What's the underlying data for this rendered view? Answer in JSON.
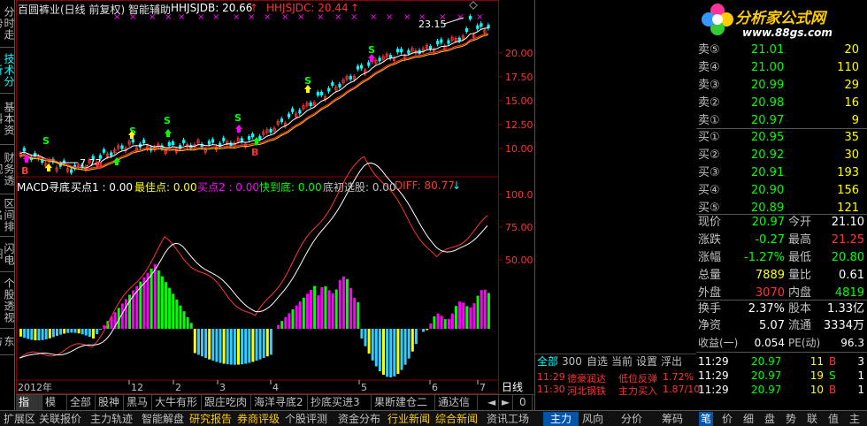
{
  "left_tabs": [
    {
      "label": "分时走势"
    },
    {
      "label": "技术分析"
    },
    {
      "label": "基本资料"
    },
    {
      "label": "财务透视"
    },
    {
      "label": "区间排名"
    },
    {
      "label": "闪电图"
    },
    {
      "label": "个股透视"
    },
    {
      "label": "东方"
    }
  ],
  "header": {
    "title": "百圆裤业(日线 前复权) 智能辅助",
    "ind1": "HHJSJDB: 20.66",
    "ind2": "HHJSJDC: 20.44",
    "arrow": "↑",
    "peak_label": "23.15",
    "low_label": "7.77"
  },
  "price_axis": [
    "20.00",
    "17.50",
    "15.00",
    "12.50",
    "10.00"
  ],
  "macd_header": {
    "title": "MACD寻底",
    "p1": "买点1 : 0.00",
    "p2": "最佳点: 0.00",
    "p3": "买点2 : 0.00",
    "p4": "快到底: 0.00",
    "p5": "底初选股: 0.00",
    "p6": "DIFF: 80.77",
    "arrow": "↓"
  },
  "macd_axis": [
    "100.0",
    "75.00",
    "50.00"
  ],
  "date_axis": {
    "year": "2012年",
    "months": [
      "12",
      "2",
      "3",
      "4",
      "5",
      "6",
      "7"
    ]
  },
  "signals": {
    "s": "S",
    "b": "B"
  },
  "bottom_tabs": [
    "指标",
    "模板",
    "全部",
    "股神",
    "黑马",
    "大牛有形",
    "跟庄吃肉",
    "海洋寻底2",
    "抄底买进3",
    "果断建仓二",
    "通达信"
  ],
  "status_tabs": [
    "扩展区",
    "关联报价",
    "主力轨迹",
    "智能解盘",
    "研究报告",
    "券商评级",
    "个股评测",
    "资金分布",
    "行业新闻",
    "综合新闻",
    "资讯工场"
  ],
  "logo": {
    "title": "分析家公式网",
    "url": "www.88gs.com"
  },
  "quote": {
    "sells": [
      {
        "l": "卖⑤",
        "p": "21.01",
        "v": "20"
      },
      {
        "l": "卖④",
        "p": "21.00",
        "v": "110"
      },
      {
        "l": "卖③",
        "p": "20.99",
        "v": "29"
      },
      {
        "l": "卖②",
        "p": "20.98",
        "v": "16"
      },
      {
        "l": "卖①",
        "p": "20.97",
        "v": "9"
      }
    ],
    "buys": [
      {
        "l": "买①",
        "p": "20.95",
        "v": "35"
      },
      {
        "l": "买②",
        "p": "20.92",
        "v": "30"
      },
      {
        "l": "买③",
        "p": "20.91",
        "v": "193"
      },
      {
        "l": "买④",
        "p": "20.90",
        "v": "156"
      },
      {
        "l": "买⑤",
        "p": "20.89",
        "v": "121"
      }
    ],
    "stats": [
      {
        "a": "现价",
        "b": "20.97",
        "c": "今开",
        "d": "21.10"
      },
      {
        "a": "涨跌",
        "b": "-0.27",
        "c": "最高",
        "d": "21.25"
      },
      {
        "a": "涨幅",
        "b": "-1.27%",
        "c": "最低",
        "d": "20.80"
      },
      {
        "a": "总量",
        "b": "7889",
        "c": "量比",
        "d": "0.61"
      },
      {
        "a": "外盘",
        "b": "3070",
        "c": "内盘",
        "d": "4819"
      },
      {
        "a": "换手",
        "b": "2.37%",
        "c": "股本",
        "d": "1.33亿"
      },
      {
        "a": "净资",
        "b": "5.07",
        "c": "流通",
        "d": "3334万"
      },
      {
        "a": "收益(一)",
        "b": "0.054",
        "c": "PE(动)",
        "d": "96.3"
      }
    ],
    "ticks": [
      {
        "t": "11:29",
        "p": "20.97",
        "v": "11",
        "s": "B",
        "n": "3"
      },
      {
        "t": "11:29",
        "p": "20.97",
        "v": "19",
        "s": "S",
        "n": "1"
      },
      {
        "t": "11:29",
        "p": "20.97",
        "v": "10",
        "s": "B",
        "n": "1"
      }
    ]
  },
  "right_tabs": [
    "全部",
    "300",
    "自选",
    "当前",
    "设置",
    "浮出"
  ],
  "news": [
    {
      "t": "11:29",
      "a": "德豪润达",
      "b": "低位反弹",
      "c": "1.72%"
    },
    {
      "t": "11:30",
      "a": "河北钢铁",
      "b": "主力买入",
      "c": "1.87/10"
    }
  ],
  "right_bottom_tabs": [
    "主力",
    "风向",
    "分价",
    "筹码"
  ],
  "tool_tabs": [
    "笔",
    "价",
    "细",
    "盘",
    "势",
    "联",
    "值",
    "主"
  ],
  "day_tab": "日线",
  "zero_tab": "0",
  "colors": {
    "up": "#ff3333",
    "down": "#00ffff",
    "magenta": "#ff00ff",
    "green": "#00ff00",
    "yellow": "#ffff00"
  }
}
